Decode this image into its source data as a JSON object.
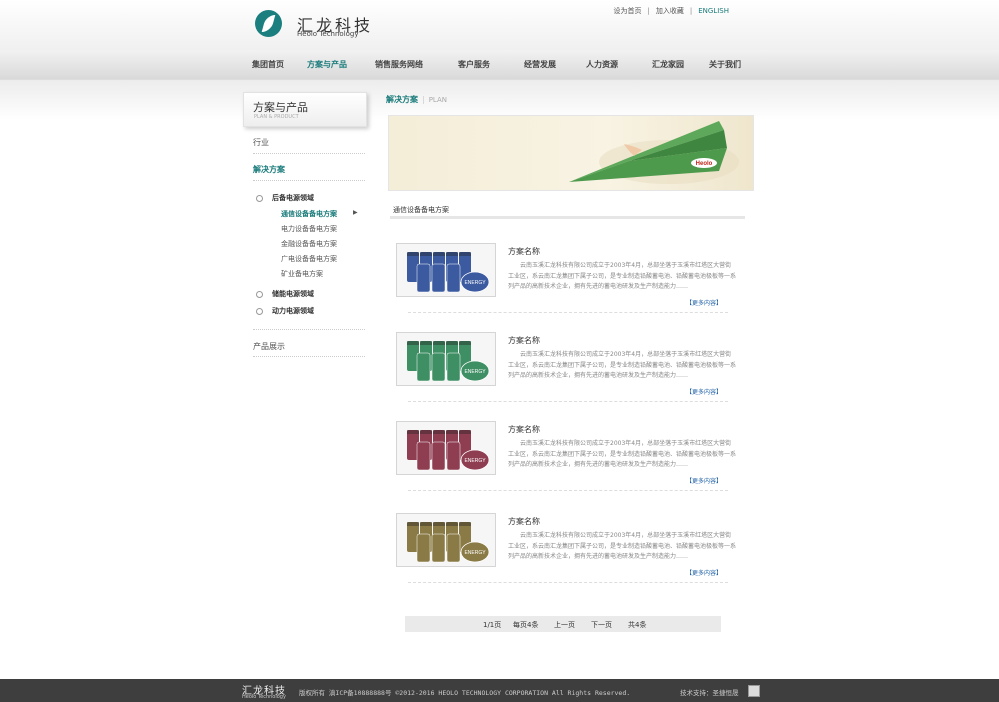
{
  "header": {
    "logo_cn": "汇龙科技",
    "logo_en": "Heolo Technology",
    "top_links": [
      "设为首页",
      "加入收藏",
      "ENGLISH"
    ]
  },
  "nav": [
    "集团首页",
    "方案与产品",
    "销售服务网络",
    "客户服务",
    "经营发展",
    "人力资源",
    "汇龙家园",
    "关于我们"
  ],
  "nav_active": "方案与产品",
  "sidebar": {
    "title": "方案与产品",
    "subtitle": "PLAN & PRODUCT",
    "industry": "行业",
    "solution": "解决方案",
    "tree": [
      {
        "label": "后备电源领域",
        "children": [
          "通信设备备电方案",
          "电力设备备电方案",
          "金融设备备电方案",
          "广电设备备电方案",
          "矿业备电方案"
        ]
      },
      {
        "label": "储能电源领域"
      },
      {
        "label": "动力电源领域"
      }
    ],
    "product": "产品展示"
  },
  "breadcrumb": {
    "current": "解决方案",
    "en": "PLAN"
  },
  "banner": {
    "plane_text": "Heolo"
  },
  "section_title": "通信设备备电方案",
  "items": [
    {
      "title": "方案名称",
      "desc": "云南玉溪汇龙科技有限公司成立于2003年4月，总部坐落于玉溪市红塔区大营街工业区，系云南汇龙集团下属子公司，是专业制造铅酸蓄电池、铅酸蓄电池极板等一系列产品的高新技术企业，拥有先进的蓄电池研发及生产制造能力……",
      "more": "【更多内容】",
      "color": "#3b5aa0",
      "thumb_label": "ENERGY"
    },
    {
      "title": "方案名称",
      "desc": "云南玉溪汇龙科技有限公司成立于2003年4月，总部坐落于玉溪市红塔区大营街工业区，系云南汇龙集团下属子公司，是专业制造铅酸蓄电池、铅酸蓄电池极板等一系列产品的高新技术企业，拥有先进的蓄电池研发及生产制造能力……",
      "more": "【更多内容】",
      "color": "#3f8f65",
      "thumb_label": "ENERGY"
    },
    {
      "title": "方案名称",
      "desc": "云南玉溪汇龙科技有限公司成立于2003年4月，总部坐落于玉溪市红塔区大营街工业区，系云南汇龙集团下属子公司，是专业制造铅酸蓄电池、铅酸蓄电池极板等一系列产品的高新技术企业，拥有先进的蓄电池研发及生产制造能力……",
      "more": "【更多内容】",
      "color": "#8f3e52",
      "thumb_label": "ENERGY"
    },
    {
      "title": "方案名称",
      "desc": "云南玉溪汇龙科技有限公司成立于2003年4月，总部坐落于玉溪市红塔区大营街工业区，系云南汇龙集团下属子公司，是专业制造铅酸蓄电池、铅酸蓄电池极板等一系列产品的高新技术企业，拥有先进的蓄电池研发及生产制造能力……",
      "more": "【更多内容】",
      "color": "#8a7a45",
      "thumb_label": "ENERGY"
    }
  ],
  "pager": {
    "page": "1/1页",
    "per_page": "每页4条",
    "prev": "上一页",
    "next": "下一页",
    "total": "共4条"
  },
  "footer": {
    "logo_cn": "汇龙科技",
    "logo_en": "Heolo Technology",
    "copyright": "版权所有 滇ICP备10888888号 ©2012-2016 HEOLO TECHNOLOGY CORPORATION All Rights Reserved.",
    "tech": "技术支持：圣捷恒晟"
  },
  "colors": {
    "accent": "#187a7a",
    "link": "#1e5fa5",
    "footer_bg": "#3e3e3e"
  }
}
